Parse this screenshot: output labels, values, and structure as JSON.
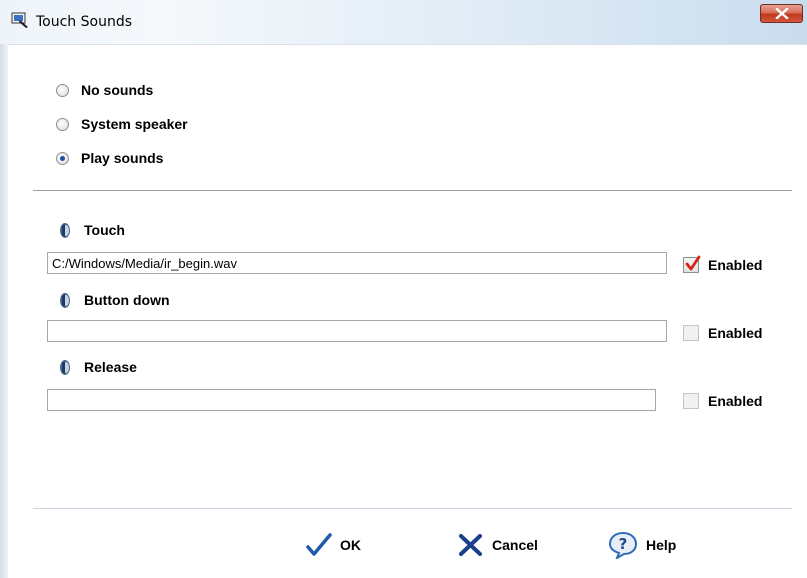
{
  "window": {
    "title": "Touch Sounds"
  },
  "mode": {
    "options": [
      {
        "label": "No sounds",
        "selected": false
      },
      {
        "label": "System speaker",
        "selected": false
      },
      {
        "label": "Play sounds",
        "selected": true
      }
    ]
  },
  "sounds": [
    {
      "label": "Touch",
      "path": "C:/Windows/Media/ir_begin.wav",
      "enabled_label": "Enabled",
      "enabled": true
    },
    {
      "label": "Button down",
      "path": "",
      "enabled_label": "Enabled",
      "enabled": false
    },
    {
      "label": "Release",
      "path": "",
      "enabled_label": "Enabled",
      "enabled": false
    }
  ],
  "buttons": {
    "ok": "OK",
    "cancel": "Cancel",
    "help": "Help"
  },
  "colors": {
    "check_red": "#d8231c",
    "ok_blue": "#1f5aa8",
    "cancel_blue": "#1c3f8a",
    "help_blue": "#2f6bb8"
  }
}
